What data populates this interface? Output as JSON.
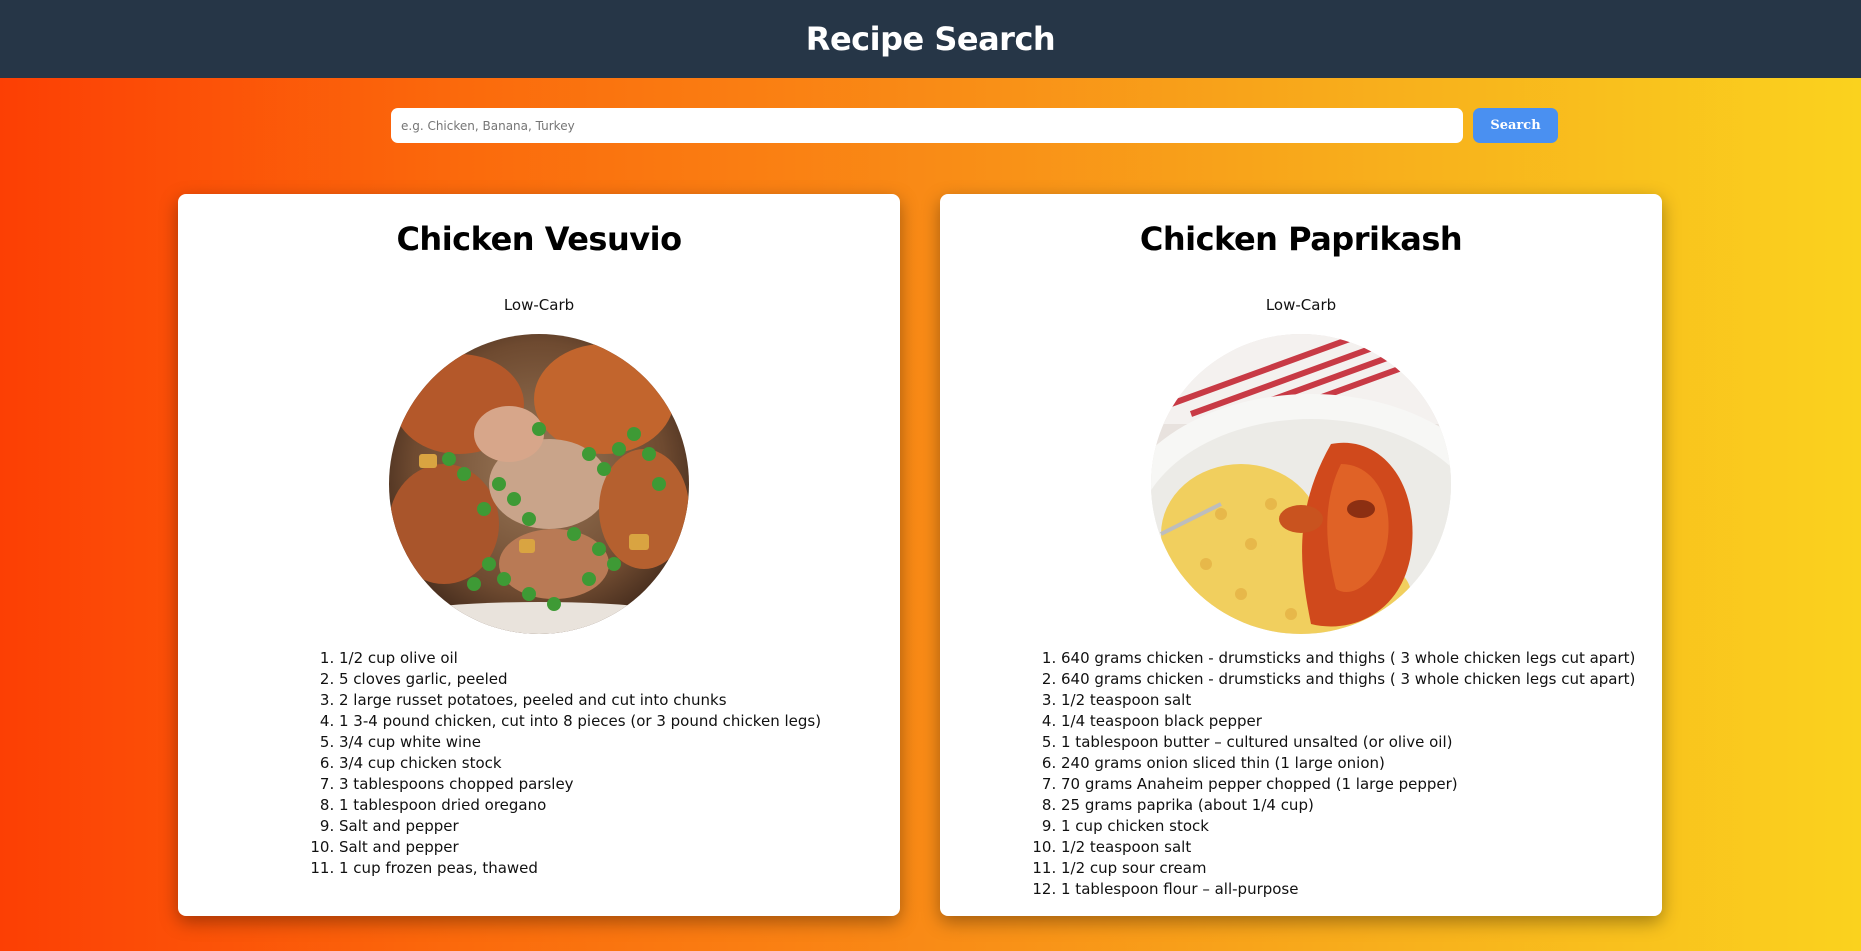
{
  "header": {
    "title": "Recipe Search"
  },
  "search": {
    "placeholder": "e.g. Chicken, Banana, Turkey",
    "value": "",
    "button_label": "Search"
  },
  "recipes": [
    {
      "title": "Chicken Vesuvio",
      "tag": "Low-Carb",
      "image_icon": "chicken-vesuvio-photo",
      "ingredients": [
        "1/2 cup olive oil",
        "5 cloves garlic, peeled",
        "2 large russet potatoes, peeled and cut into chunks",
        "1 3-4 pound chicken, cut into 8 pieces (or 3 pound chicken legs)",
        "3/4 cup white wine",
        "3/4 cup chicken stock",
        "3 tablespoons chopped parsley",
        "1 tablespoon dried oregano",
        "Salt and pepper",
        "Salt and pepper",
        "1 cup frozen peas, thawed"
      ]
    },
    {
      "title": "Chicken Paprikash",
      "tag": "Low-Carb",
      "image_icon": "chicken-paprikash-photo",
      "ingredients": [
        "640 grams chicken - drumsticks and thighs ( 3 whole chicken legs cut apart)",
        "640 grams chicken - drumsticks and thighs ( 3 whole chicken legs cut apart)",
        "1/2 teaspoon salt",
        "1/4 teaspoon black pepper",
        "1 tablespoon butter – cultured unsalted (or olive oil)",
        "240 grams onion sliced thin (1 large onion)",
        "70 grams Anaheim pepper chopped (1 large pepper)",
        "25 grams paprika (about 1/4 cup)",
        "1 cup chicken stock",
        "1/2 teaspoon salt",
        "1/2 cup sour cream",
        "1 tablespoon flour – all-purpose"
      ]
    }
  ],
  "colors": {
    "header_bg": "#263647",
    "button_bg": "#4a90f1",
    "gradient_start": "#fc3f04",
    "gradient_end": "#fad21e"
  }
}
